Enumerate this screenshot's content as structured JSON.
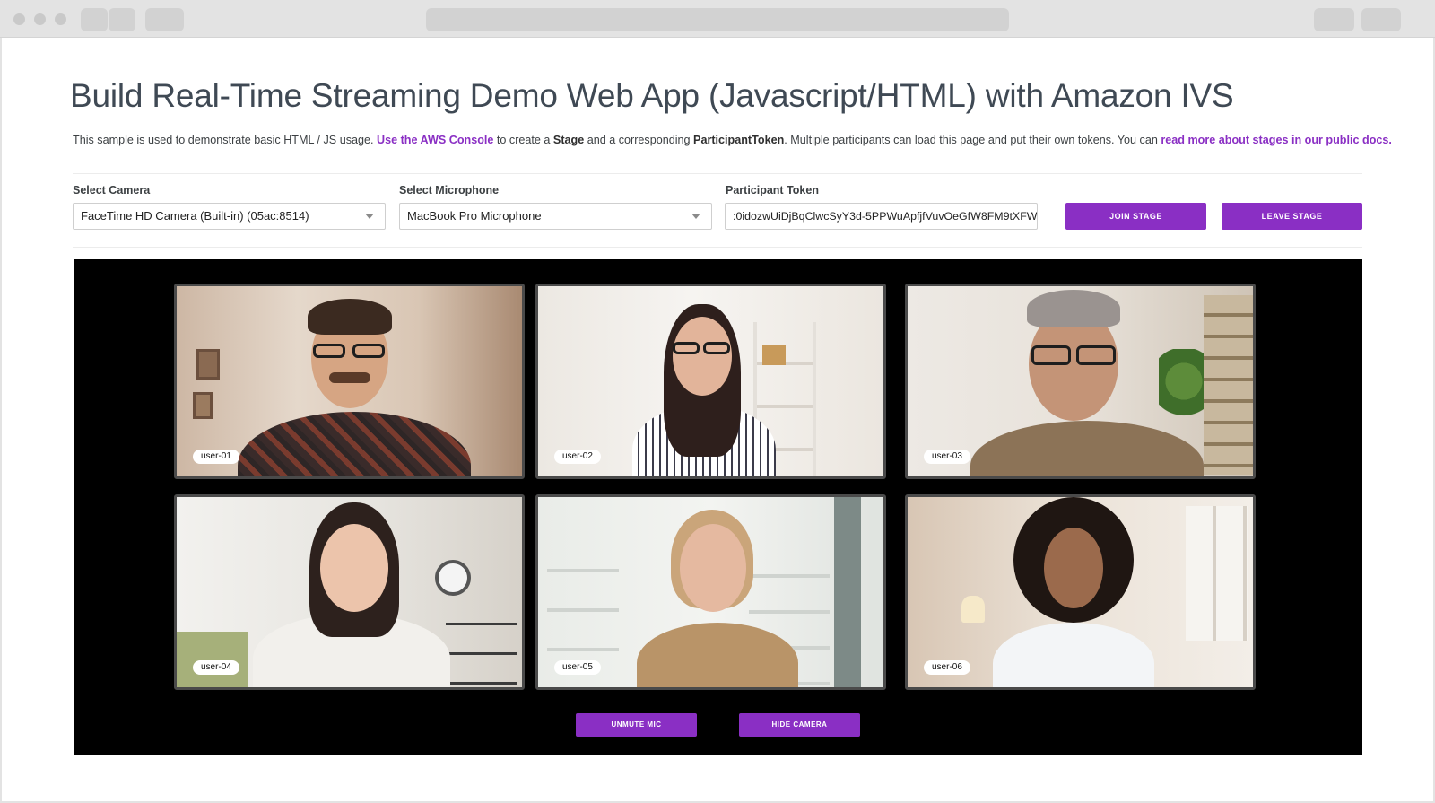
{
  "header": {
    "title": "Build Real-Time Streaming Demo Web App (Javascript/HTML) with Amazon IVS",
    "intro": {
      "part1": "This sample is used to demonstrate basic HTML / JS usage. ",
      "link1": "Use the AWS Console",
      "part2": " to create a ",
      "stage_word": "Stage",
      "part3": " and a corresponding ",
      "token_word": "ParticipantToken",
      "part4": ". Multiple participants can load this page and put their own tokens. You can ",
      "link2": "read more about stages in our public docs."
    }
  },
  "controls": {
    "camera": {
      "label": "Select Camera",
      "value": "FaceTime HD Camera (Built-in) (05ac:8514)"
    },
    "microphone": {
      "label": "Select Microphone",
      "value": "MacBook Pro Microphone"
    },
    "token": {
      "label": "Participant Token",
      "value": ":0idozwUiDjBqClwcSyY3d-5PPWuApfjfVuvOeGfW8FM9tXFW"
    },
    "join_label": "Join Stage",
    "leave_label": "Leave Stage"
  },
  "participants": [
    {
      "name": "user-01"
    },
    {
      "name": "user-02"
    },
    {
      "name": "user-03"
    },
    {
      "name": "user-04"
    },
    {
      "name": "user-05"
    },
    {
      "name": "user-06"
    }
  ],
  "stage_controls": {
    "mic_label": "Unmute Mic",
    "camera_label": "Hide Camera"
  },
  "colors": {
    "accent": "#8a2fc4",
    "stage_bg": "#000000"
  }
}
